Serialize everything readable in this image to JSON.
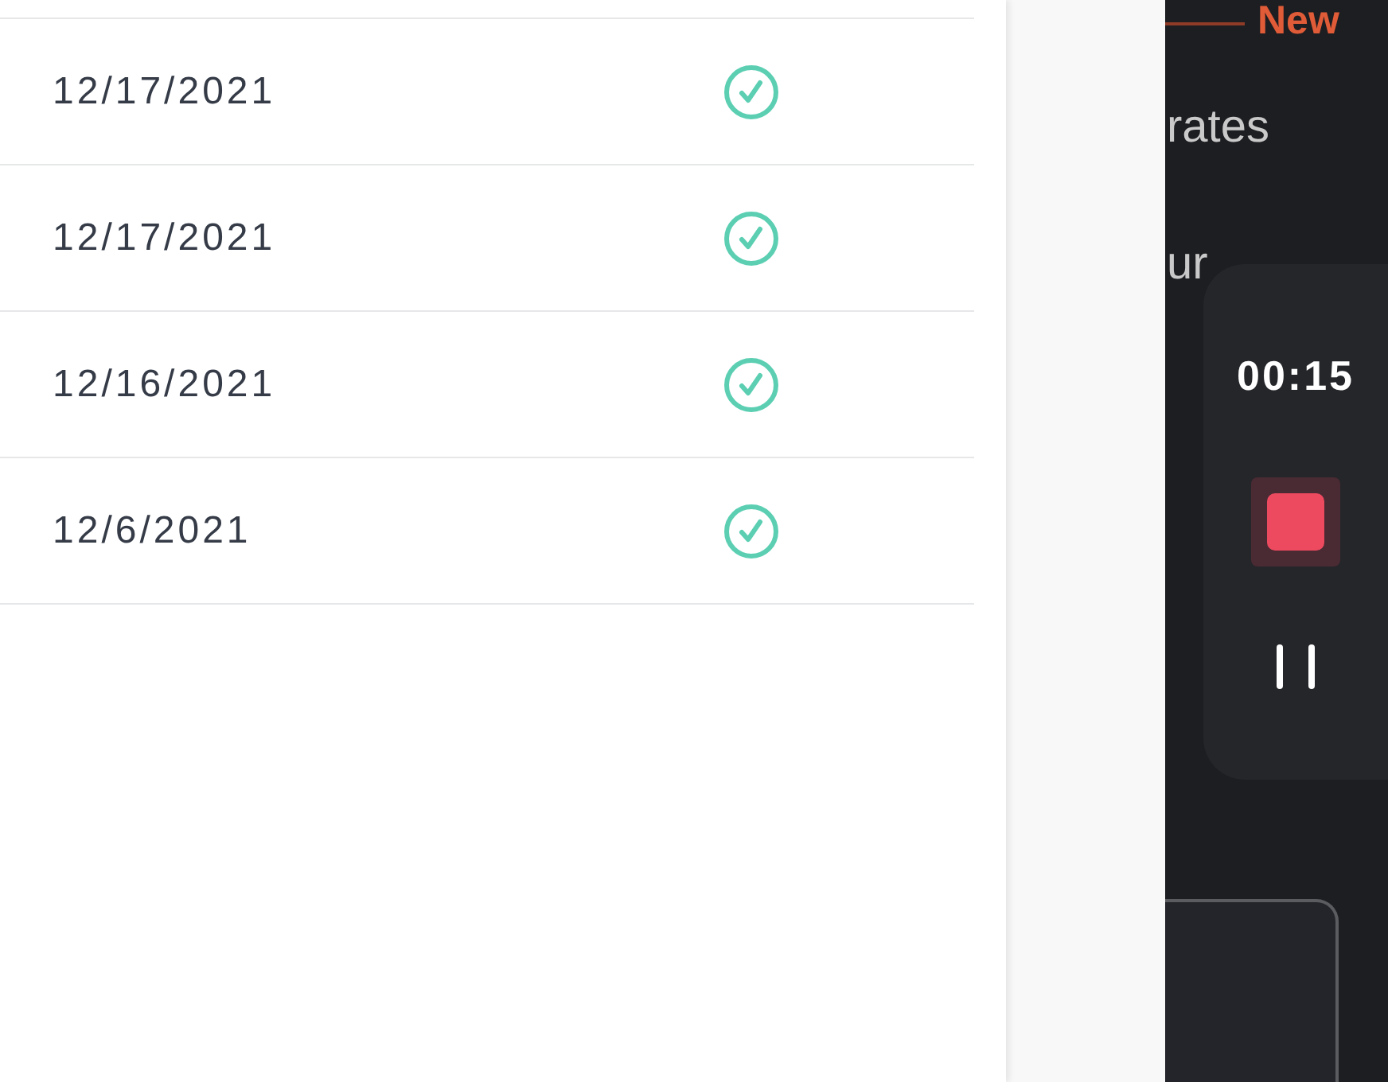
{
  "table": {
    "rows": [
      {
        "date": "12/17/2021",
        "complete": true
      },
      {
        "date": "12/17/2021",
        "complete": true
      },
      {
        "date": "12/16/2021",
        "complete": true
      },
      {
        "date": "12/6/2021",
        "complete": true
      }
    ]
  },
  "background_screen": {
    "badge": "New",
    "text_lines": [
      "rates",
      "ur"
    ]
  },
  "recorder": {
    "time": "00:15"
  }
}
